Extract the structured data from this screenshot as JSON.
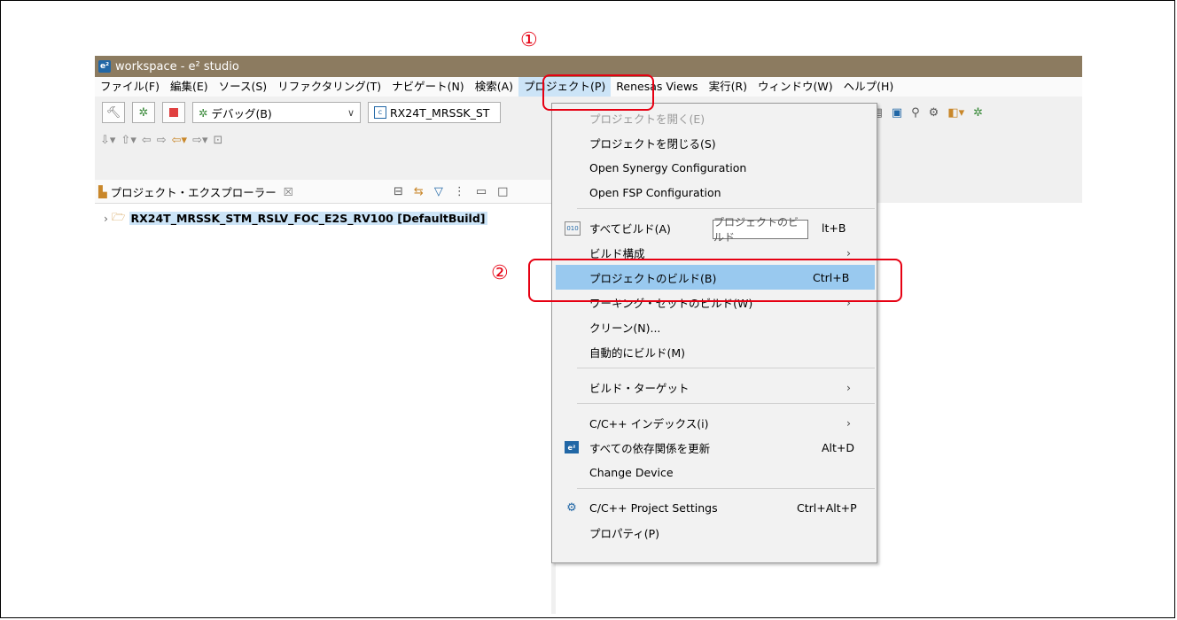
{
  "window": {
    "title": "workspace - e² studio",
    "logo_text": "e²"
  },
  "menubar": [
    "ファイル(F)",
    "編集(E)",
    "ソース(S)",
    "リファクタリング(T)",
    "ナビゲート(N)",
    "検索(A)",
    "プロジェクト(P)",
    "Renesas Views",
    "実行(R)",
    "ウィンドウ(W)",
    "ヘルプ(H)"
  ],
  "toolbar": {
    "build_config": "デバッグ(B)",
    "project_combo": "RX24T_MRSSK_ST"
  },
  "explorer": {
    "title": "プロジェクト・エクスプローラー",
    "close": "☒",
    "project": "RX24T_MRSSK_STM_RSLV_FOC_E2S_RV100 [DefaultBuild]"
  },
  "project_menu": {
    "open_project": "プロジェクトを開く(E)",
    "close_project": "プロジェクトを閉じる(S)",
    "open_synergy": "Open Synergy Configuration",
    "open_fsp": "Open FSP Configuration",
    "build_all": "すべてビルド(A)",
    "build_all_shortcut": "lt+B",
    "build_config": "ビルド構成",
    "build_project": "プロジェクトのビルド(B)",
    "build_project_shortcut": "Ctrl+B",
    "build_working_set": "ワーキング・セットのビルド(W)",
    "clean": "クリーン(N)...",
    "auto_build": "自動的にビルド(M)",
    "build_targets": "ビルド・ターゲット",
    "index": "C/C++ インデックス(i)",
    "update_deps": "すべての依存関係を更新",
    "update_deps_shortcut": "Alt+D",
    "change_device": "Change Device",
    "project_settings": "C/C++ Project Settings",
    "project_settings_shortcut": "Ctrl+Alt+P",
    "properties": "プロパティ(P)",
    "submenu_arrow": "›"
  },
  "tooltip": "プロジェクトのビルド",
  "annotations": {
    "step1": "①",
    "step2": "②"
  },
  "colors": {
    "callout": "#e60012",
    "titlebar": "#8c7b60",
    "highlight": "#99c9ef"
  }
}
